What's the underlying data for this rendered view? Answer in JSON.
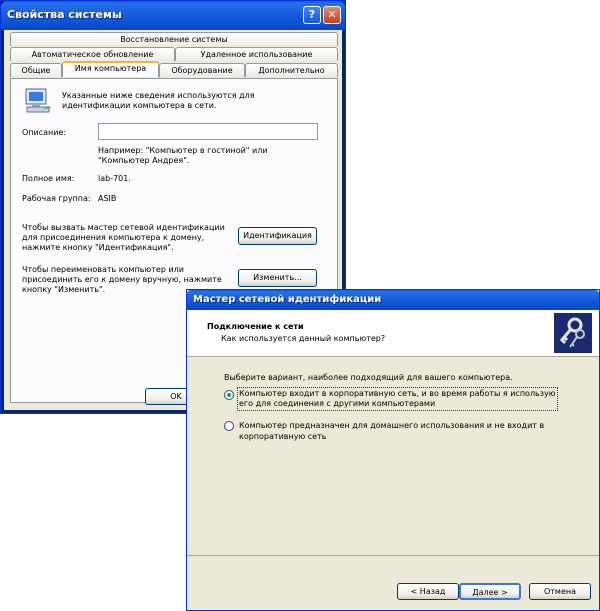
{
  "system_properties": {
    "title": "Свойства системы",
    "help_glyph": "?",
    "close_glyph": "✕",
    "tabs_row1": [
      "Восстановление системы"
    ],
    "tabs_row2": [
      "Автоматическое обновление",
      "Удаленное использование"
    ],
    "tabs_row3": [
      "Общие",
      "Имя компьютера",
      "Оборудование",
      "Дополнительно"
    ],
    "active_tab": "Имя компьютера",
    "intro_line1": "Указанные ниже сведения используются для",
    "intro_line2": "идентификации компьютера в сети.",
    "description_label": "Описание:",
    "description_value": "",
    "example_line1": "Например: \"Компьютер в гостиной\" или",
    "example_line2": "\"Компьютер Андрея\".",
    "fullname_label": "Полное имя:",
    "fullname_value": "lab-701.",
    "workgroup_label": "Рабочая группа:",
    "workgroup_value": "ASIB",
    "wizard_text_line1": "Чтобы вызвать мастер сетевой идентификации",
    "wizard_text_line2": "для присоединения компьютера к домену,",
    "wizard_text_line3": "нажмите кнопку \"Идентификация\".",
    "identify_button": "Идентификация",
    "rename_text_line1": "Чтобы переименовать компьютер или",
    "rename_text_line2": "присоединить его к домену вручную, нажмите",
    "rename_text_line3": "кнопку \"Изменить\".",
    "change_button": "Изменить...",
    "ok_button": "OK"
  },
  "network_wizard": {
    "title": "Мастер сетевой идентификации",
    "header_title": "Подключение к сети",
    "header_subtitle": "Как используется данный компьютер?",
    "prompt": "Выберите вариант, наиболее подходящий для вашего компьютера.",
    "option1_line1": "Компьютер входит в корпоративную сеть, и во время работы я использую",
    "option1_line2": "его для соединения с другими компьютерами",
    "option2_line1": "Компьютер предназначен для домашнего использования и не входит в",
    "option2_line2": "корпоративную сеть",
    "selected_option": 1,
    "back_button": "< Назад",
    "next_button": "Далее >",
    "cancel_button": "Отмена"
  }
}
